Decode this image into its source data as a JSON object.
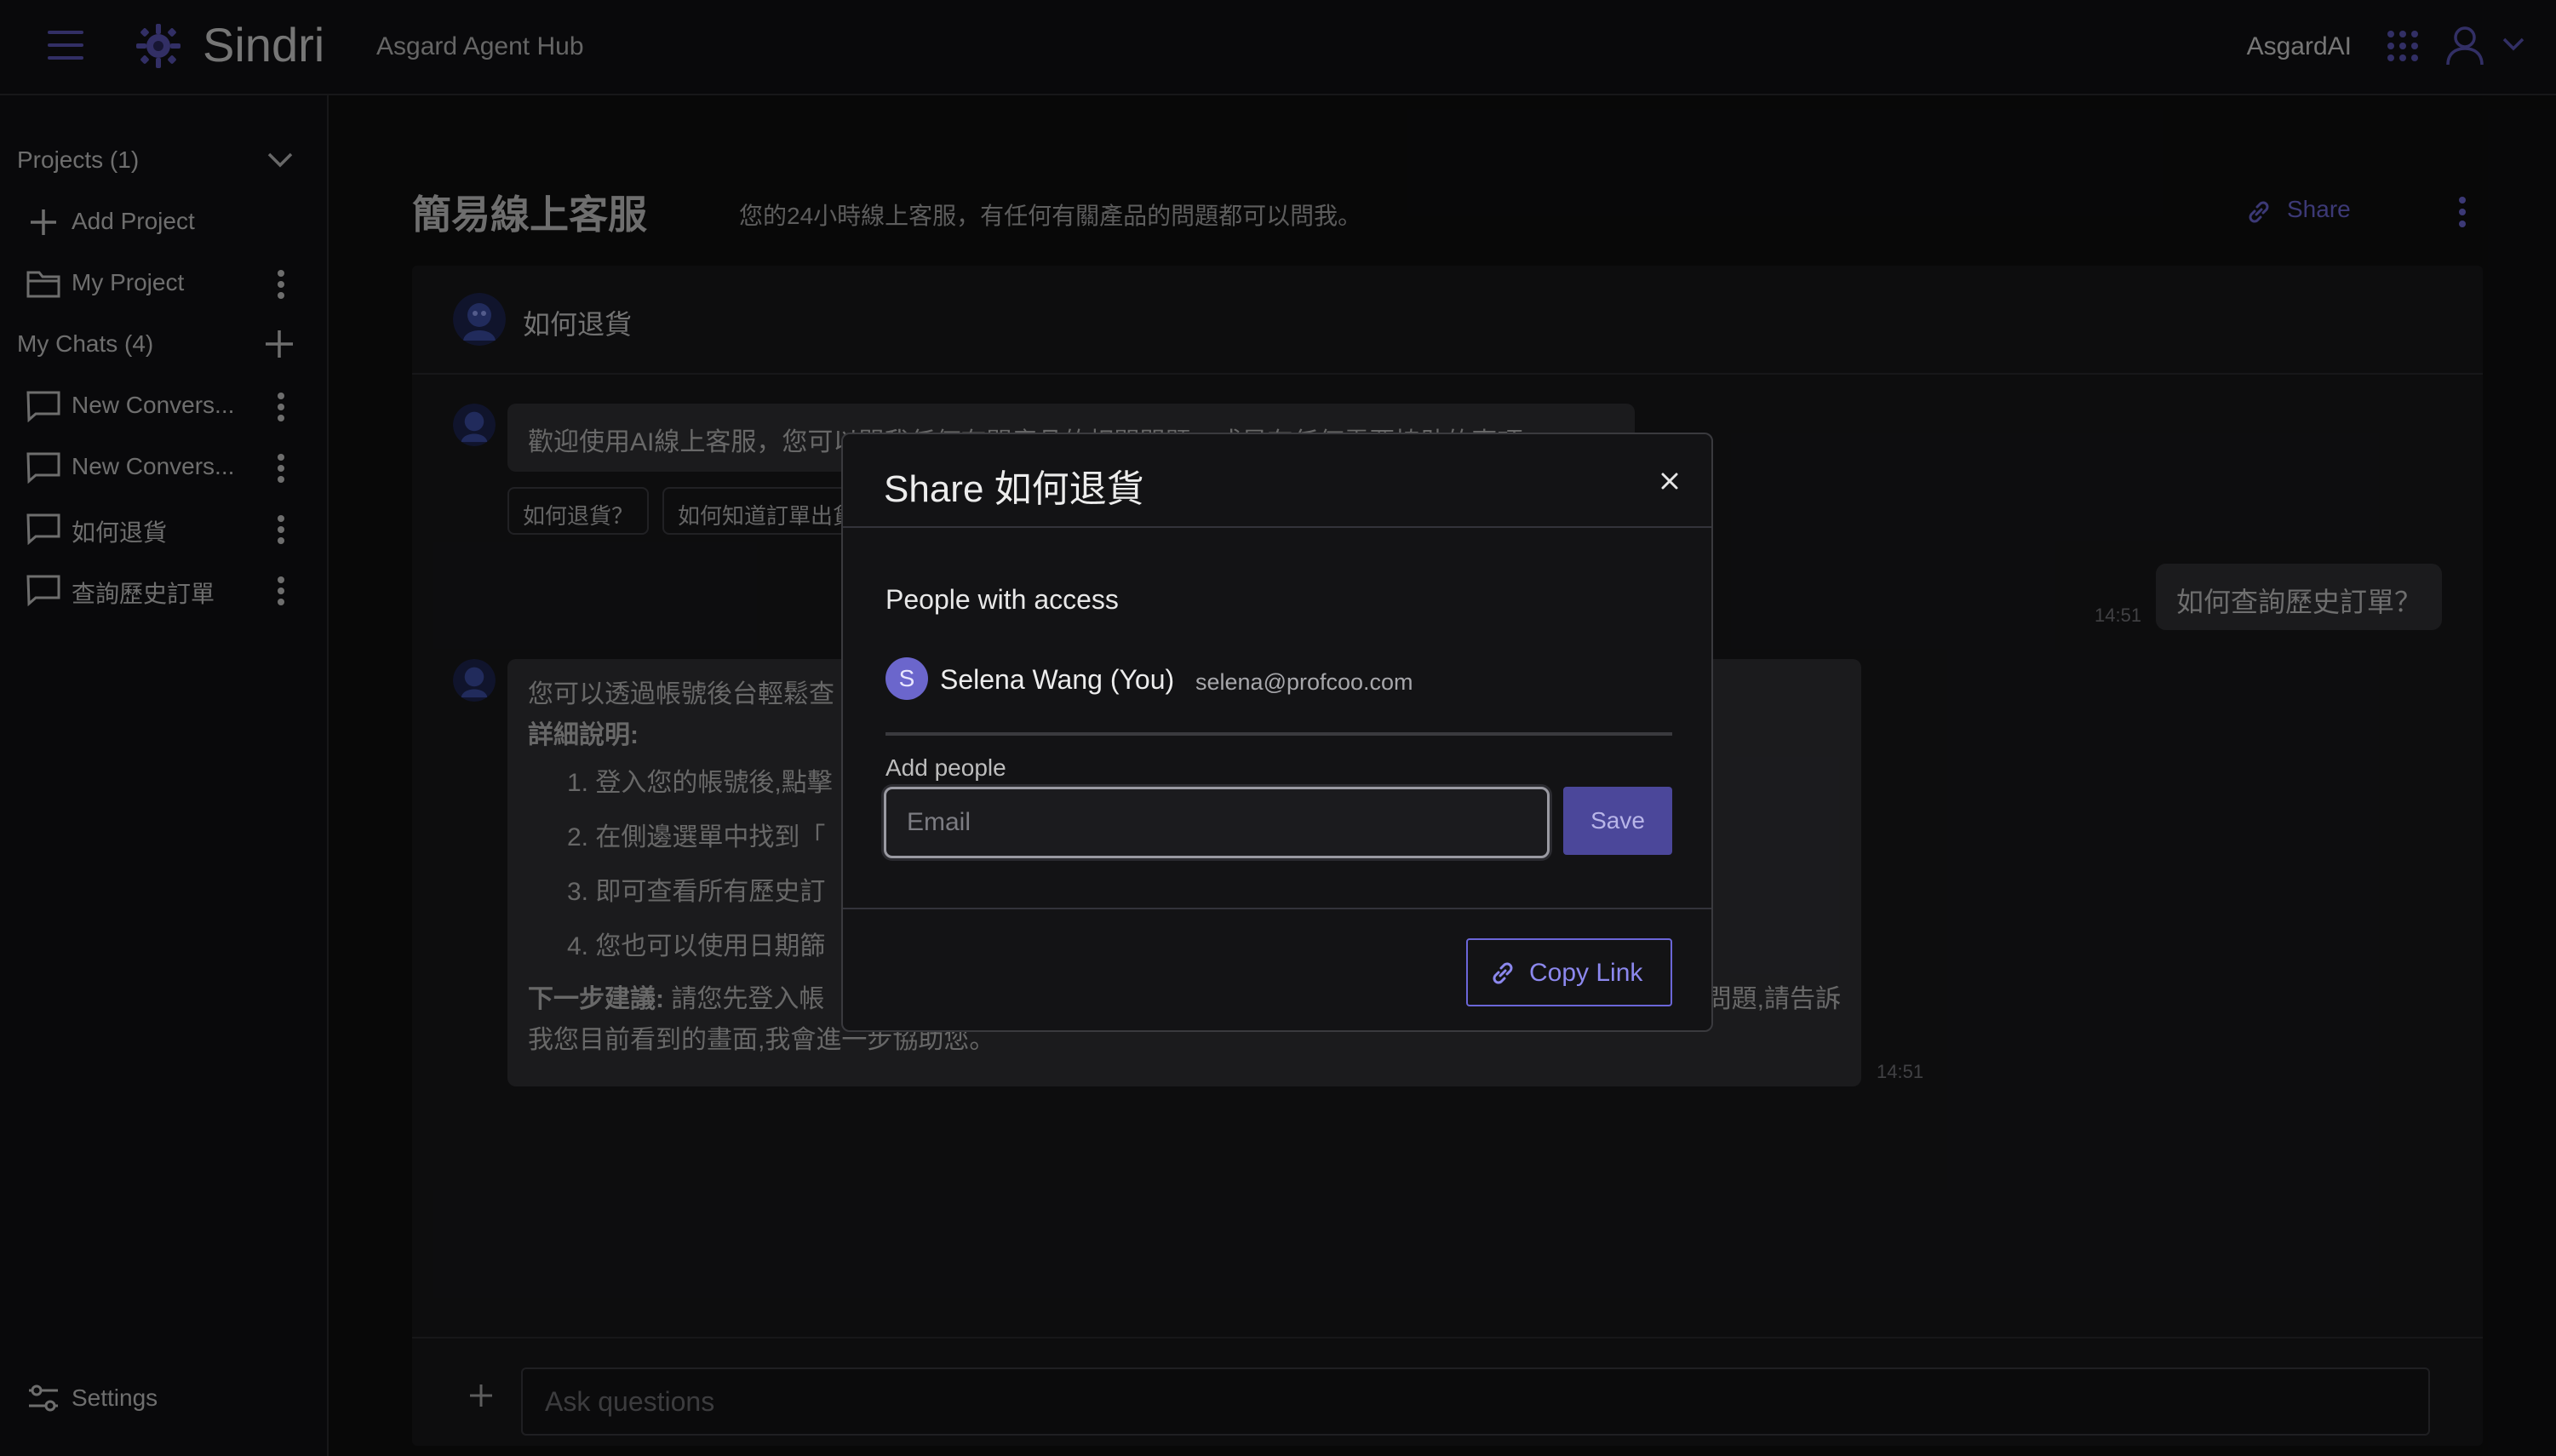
{
  "header": {
    "brand": "Sindri",
    "hub_label": "Asgard Agent Hub",
    "org_name": "AsgardAI"
  },
  "sidebar": {
    "projects_label": "Projects (1)",
    "add_project_label": "Add Project",
    "project_items": [
      {
        "label": "My Project"
      }
    ],
    "chats_label": "My Chats (4)",
    "chat_items": [
      {
        "label": "New Convers..."
      },
      {
        "label": "New Convers..."
      },
      {
        "label": "如何退貨"
      },
      {
        "label": "查詢歷史訂單"
      }
    ],
    "settings_label": "Settings"
  },
  "main": {
    "title": "簡易線上客服",
    "description": "您的24小時線上客服，有任何有關產品的問題都可以問我。",
    "share_label": "Share",
    "chat_title": "如何退貨",
    "welcome_message": "歡迎使用AI線上客服，您可以問我任何有關產品的相關問題，或是有任何需要協助的事項",
    "suggestions": [
      "如何退貨？",
      "如何知道訂單出貨"
    ],
    "user_message": "如何查詢歷史訂單？",
    "user_time": "14:51",
    "bot_reply": {
      "intro": "您可以透過帳號後台輕鬆查",
      "details_heading": "詳細說明:",
      "steps": [
        "1. 登入您的帳號後,點擊",
        "2. 在側邊選單中找到「",
        "3. 即可查看所有歷史訂",
        "4. 您也可以使用日期篩"
      ],
      "next_heading": "下一步建議:",
      "next_text": " 請您先登入帳",
      "next_tail": "問題,請告訴",
      "closing": "我您目前看到的畫面,我會進一步協助您。",
      "time": "14:51"
    },
    "input_placeholder": "Ask questions"
  },
  "modal": {
    "title": "Share 如何退貨",
    "people_heading": "People with access",
    "person": {
      "initial": "S",
      "name": "Selena Wang (You)",
      "email": "selena@profcoo.com"
    },
    "add_people_label": "Add people",
    "email_placeholder": "Email",
    "email_value": "",
    "save_label": "Save",
    "copy_link_label": "Copy Link"
  },
  "colors": {
    "accent": "#6b66d8",
    "background": "#0f0f10",
    "panel": "#18181b"
  }
}
